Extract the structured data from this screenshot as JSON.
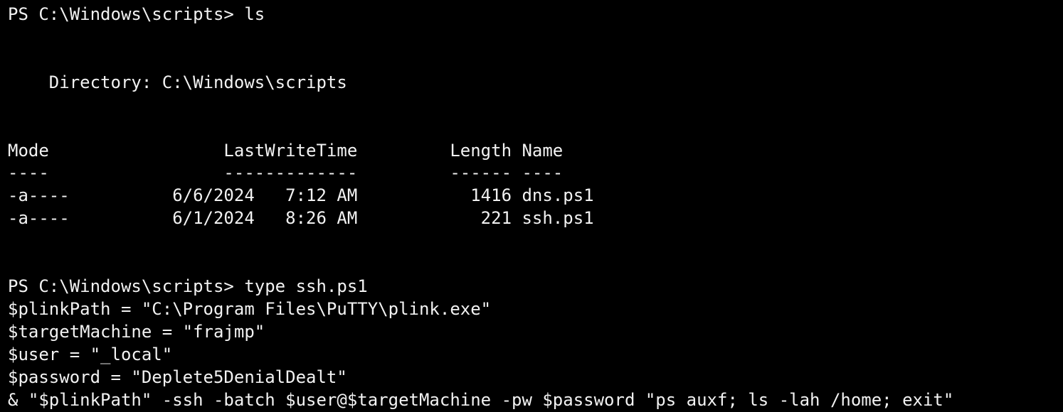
{
  "terminal": {
    "background": "#000000",
    "foreground": "#f2f2f2",
    "prompt_ls": "PS C:\\Windows\\scripts> ls",
    "directory_line": "    Directory: C:\\Windows\\scripts",
    "table": {
      "header": "Mode                 LastWriteTime         Length Name",
      "underline": "----                 -------------         ------ ----",
      "rows": [
        "-a----          6/6/2024   7:12 AM           1416 dns.ps1",
        "-a----          6/1/2024   8:26 AM            221 ssh.ps1"
      ]
    },
    "prompt_type": "PS C:\\Windows\\scripts> type ssh.ps1",
    "script_lines": [
      "$plinkPath = \"C:\\Program Files\\PuTTY\\plink.exe\"",
      "$targetMachine = \"frajmp\"",
      "$user = \"_local\"",
      "$password = \"Deplete5DenialDealt\"",
      "& \"$plinkPath\" -ssh -batch $user@$targetMachine -pw $password \"ps auxf; ls -lah /home; exit\""
    ]
  }
}
